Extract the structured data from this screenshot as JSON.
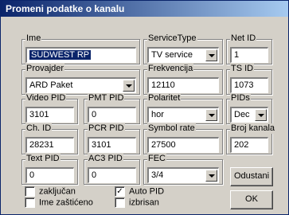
{
  "title": "Promeni podatke o kanalu",
  "fields": {
    "ime": {
      "label": "Ime",
      "value": "SUDWEST RP"
    },
    "service_type": {
      "label": "ServiceType",
      "value": "TV service"
    },
    "net_id": {
      "label": "Net ID",
      "value": "1"
    },
    "provajder": {
      "label": "Provajder",
      "value": "ARD Paket"
    },
    "frekvencija": {
      "label": "Frekvencija",
      "value": "12110"
    },
    "ts_id": {
      "label": "TS ID",
      "value": "1073"
    },
    "video_pid": {
      "label": "Video PID",
      "value": "3101"
    },
    "pmt_pid": {
      "label": "PMT PID",
      "value": "0"
    },
    "polaritet": {
      "label": "Polaritet",
      "value": "hor"
    },
    "pids": {
      "label": "PIDs",
      "value": "Dec"
    },
    "ch_id": {
      "label": "Ch. ID",
      "value": "28231"
    },
    "pcr_pid": {
      "label": "PCR PID",
      "value": "3101"
    },
    "symbol_rate": {
      "label": "Symbol rate",
      "value": "27500"
    },
    "broj_kanala": {
      "label": "Broj kanala",
      "value": "202"
    },
    "text_pid": {
      "label": "Text PID",
      "value": "0"
    },
    "ac3_pid": {
      "label": "AC3 PID",
      "value": "0"
    },
    "fec": {
      "label": "FEC",
      "value": "3/4"
    }
  },
  "checkboxes": {
    "zakljucan": {
      "label": "zaključan",
      "checked": false,
      "mark": ""
    },
    "ime_zasticeno": {
      "label": "Ime zaštićeno",
      "checked": false,
      "mark": ""
    },
    "auto_pid": {
      "label": "Auto PID",
      "checked": true,
      "mark": "✓"
    },
    "izbrisan": {
      "label": "izbrisan",
      "checked": false,
      "mark": ""
    }
  },
  "buttons": {
    "cancel": "Odustani",
    "ok": "OK"
  }
}
